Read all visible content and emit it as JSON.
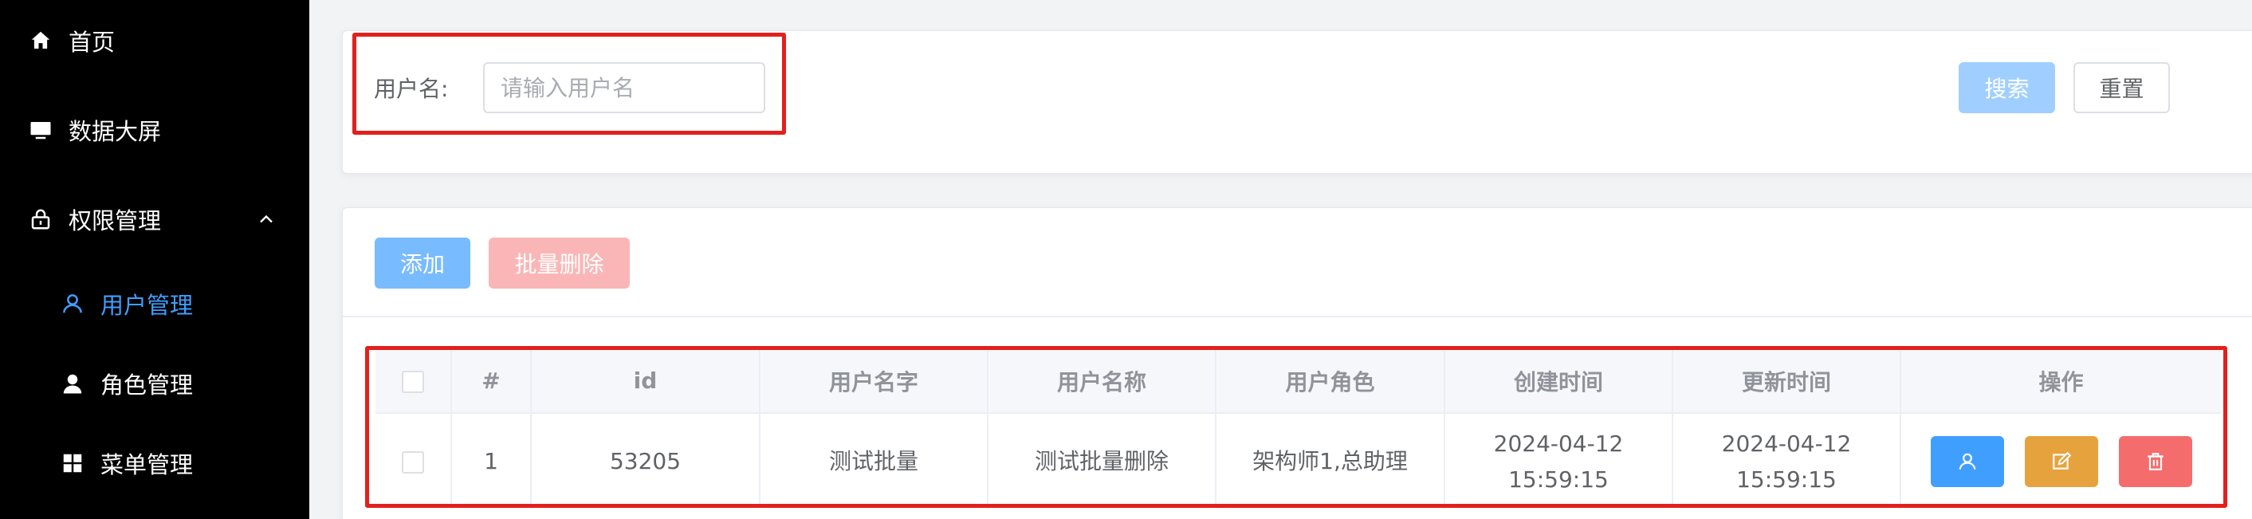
{
  "sidebar": {
    "items": [
      {
        "label": "首页",
        "icon": "home-icon"
      },
      {
        "label": "数据大屏",
        "icon": "monitor-icon"
      },
      {
        "label": "权限管理",
        "icon": "lock-icon",
        "expanded": true
      },
      {
        "label": "用户管理",
        "icon": "user-icon",
        "active": true
      },
      {
        "label": "角色管理",
        "icon": "user-filled-icon"
      },
      {
        "label": "菜单管理",
        "icon": "grid-icon"
      }
    ],
    "active_color": "#409eff",
    "background": "#000000"
  },
  "search": {
    "label": "用户名:",
    "placeholder": "请输入用户名",
    "value": "",
    "search_button": "搜索",
    "reset_button": "重置"
  },
  "toolbar": {
    "add_button": "添加",
    "batch_delete_button": "批量删除"
  },
  "table": {
    "columns": [
      "#",
      "id",
      "用户名字",
      "用户名称",
      "用户角色",
      "创建时间",
      "更新时间",
      "操作"
    ],
    "rows": [
      {
        "index": "1",
        "id": "53205",
        "username": "测试批量",
        "name": "测试批量删除",
        "roles": "架构师1,总助理",
        "created_date": "2024-04-12",
        "created_time": "15:59:15",
        "updated_date": "2024-04-12",
        "updated_time": "15:59:15"
      }
    ]
  },
  "colors": {
    "primary": "#409eff",
    "warning": "#e6a23c",
    "danger": "#f56c6c",
    "highlight_box": "#e3201e"
  }
}
